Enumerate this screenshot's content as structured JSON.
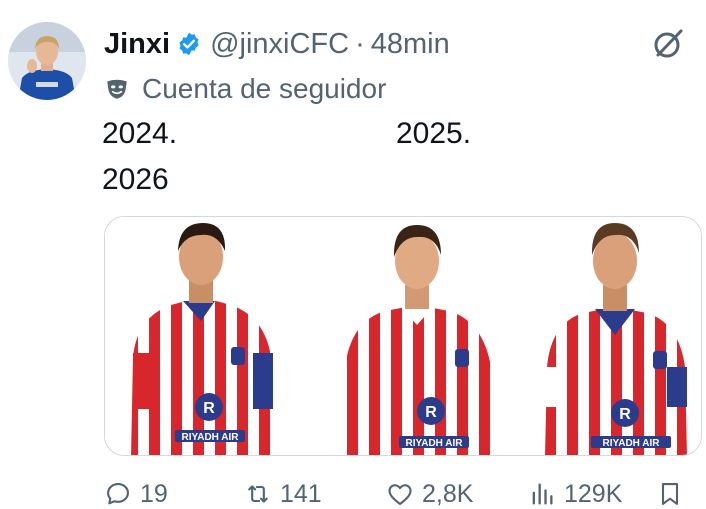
{
  "author": {
    "display_name": "Jinxi",
    "handle": "@jinxiCFC",
    "separator": "·",
    "time_ago": "48min",
    "verified": true,
    "avatar": "profile-photo"
  },
  "account_label": {
    "icon": "mask-icon",
    "text": "Cuenta de seguidor"
  },
  "tweet": {
    "lines": [
      "2024.",
      "2025.",
      "2026"
    ]
  },
  "media": {
    "players": [
      {
        "kit_sponsor": "RIYADH AIR"
      },
      {
        "kit_sponsor": "RIYADH AIR"
      },
      {
        "kit_sponsor": "RIYADH AIR"
      }
    ]
  },
  "actions": {
    "replies": "19",
    "reposts": "141",
    "likes": "2,8K",
    "views": "129K"
  },
  "colors": {
    "verified_blue": "#1d9bf0",
    "kit_red": "#d7262c",
    "kit_navy": "#2c3c8c",
    "secondary_text": "#536471"
  }
}
